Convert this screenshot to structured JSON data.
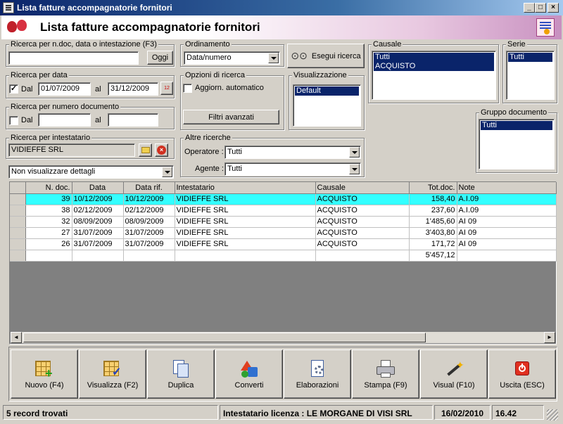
{
  "window": {
    "title": "Lista fatture accompagnatorie fornitori",
    "minimize": "_",
    "maximize": "□",
    "close": "×"
  },
  "header": {
    "title": "Lista fatture accompagnatorie fornitori"
  },
  "search_ndoc": {
    "label": "Ricerca per n.doc, data o intestazione (F3)",
    "value": "",
    "button": "Oggi"
  },
  "ordinamento": {
    "label": "Ordinamento",
    "value": "Data/numero"
  },
  "esegui": {
    "label": "Esegui ricerca"
  },
  "causale": {
    "label": "Causale",
    "items": [
      "Tutti",
      "ACQUISTO"
    ]
  },
  "serie": {
    "label": "Serie",
    "items": [
      "Tutti"
    ]
  },
  "ricerca_data": {
    "label": "Ricerca per data",
    "checked": "✓",
    "dal_label": "Dal",
    "dal": "01/07/2009",
    "al_label": "al",
    "al": "31/12/2009",
    "cal_icon": "12"
  },
  "opzioni": {
    "label": "Opzioni di ricerca",
    "aggiorn_label": "Aggiorn. automatico",
    "filtri": "Filtri avanzati"
  },
  "visualizzazione": {
    "label": "Visualizzazione",
    "items": [
      "Default"
    ]
  },
  "ricerca_numero": {
    "label": "Ricerca per numero documento",
    "dal_label": "Dal",
    "al_label": "al"
  },
  "gruppo": {
    "label": "Gruppo documento",
    "items": [
      "Tutti"
    ]
  },
  "intestatario": {
    "label": "Ricerca per intestatario",
    "value": "VIDIEFFE SRL"
  },
  "altre": {
    "label": "Altre ricerche",
    "operatore_label": "Operatore :",
    "operatore": "Tutti",
    "agente_label": "Agente :",
    "agente": "Tutti"
  },
  "dettagli": {
    "value": "Non visualizzare dettagli"
  },
  "table": {
    "columns": [
      "N. doc.",
      "Data",
      "Data rif.",
      "Intestatario",
      "Causale",
      "Tot.doc.",
      "Note"
    ],
    "rows": [
      [
        "39",
        "10/12/2009",
        "10/12/2009",
        "VIDIEFFE SRL",
        "ACQUISTO",
        "158,40",
        "A.I.09"
      ],
      [
        "38",
        "02/12/2009",
        "02/12/2009",
        "VIDIEFFE SRL",
        "ACQUISTO",
        "237,60",
        "A.I.09"
      ],
      [
        "32",
        "08/09/2009",
        "08/09/2009",
        "VIDIEFFE SRL",
        "ACQUISTO",
        "1'485,60",
        "AI 09"
      ],
      [
        "27",
        "31/07/2009",
        "31/07/2009",
        "VIDIEFFE SRL",
        "ACQUISTO",
        "3'403,80",
        "AI 09"
      ],
      [
        "26",
        "31/07/2009",
        "31/07/2009",
        "VIDIEFFE SRL",
        "ACQUISTO",
        "171,72",
        "AI 09"
      ]
    ],
    "total": "5'457,12",
    "scroll_left": "◄",
    "scroll_right": "►"
  },
  "toolbar": {
    "nuovo": "Nuovo (F4)",
    "visualizza": "Visualizza (F2)",
    "duplica": "Duplica",
    "converti": "Converti",
    "elaborazioni": "Elaborazioni",
    "stampa": "Stampa (F9)",
    "visual": "Visual (F10)",
    "uscita": "Uscita (ESC)"
  },
  "status": {
    "records": "5 record trovati",
    "licenza": "Intestatario licenza : LE MORGANE DI VISI SRL",
    "date": "16/02/2010",
    "time": "16.42"
  }
}
